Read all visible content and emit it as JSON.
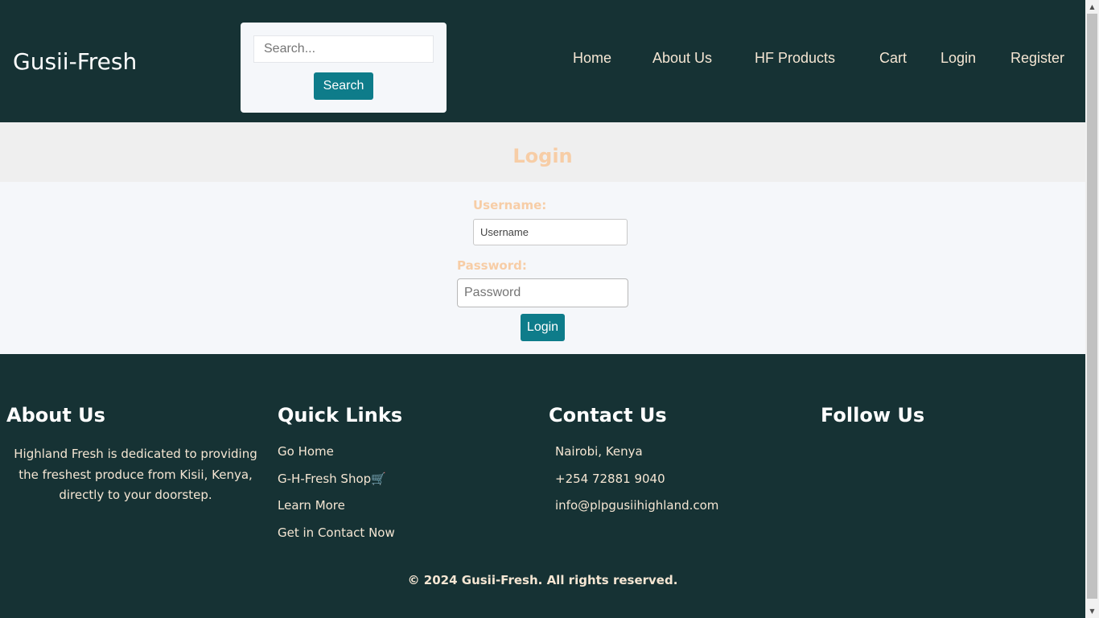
{
  "header": {
    "brand": "Gusii-Fresh",
    "search": {
      "placeholder": "Search...",
      "value": "",
      "button_label": "Search"
    },
    "nav": [
      {
        "label": "Home"
      },
      {
        "label": "About Us"
      },
      {
        "label": "HF Products"
      },
      {
        "label": "Cart"
      },
      {
        "label": "Login"
      },
      {
        "label": "Register"
      }
    ]
  },
  "login": {
    "title": "Login",
    "username_label": "Username:",
    "username_placeholder": "Username",
    "password_label": "Password:",
    "password_placeholder": "Password",
    "submit_label": "Login"
  },
  "footer": {
    "about": {
      "heading": "About Us",
      "text": "Highland Fresh is dedicated to providing the freshest produce from Kisii, Kenya, directly to your doorstep."
    },
    "quick_links": {
      "heading": "Quick Links",
      "items": [
        {
          "label": "Go Home"
        },
        {
          "label": "G-H-Fresh Shop🛒"
        },
        {
          "label": "Learn More"
        },
        {
          "label": "Get in Contact Now"
        }
      ]
    },
    "contact": {
      "heading": "Contact Us",
      "items": [
        {
          "label": "Nairobi, Kenya"
        },
        {
          "label": "+254 72881 9040"
        },
        {
          "label": "info@plpgusiihighland.com"
        }
      ]
    },
    "follow": {
      "heading": "Follow Us"
    },
    "copyright": "© 2024 Gusii-Fresh. All rights reserved."
  },
  "colors": {
    "header_bg": "#163234",
    "accent_button": "#0e7c8a",
    "peach_text": "#f7cda6",
    "light_text": "#f5e6d3"
  }
}
